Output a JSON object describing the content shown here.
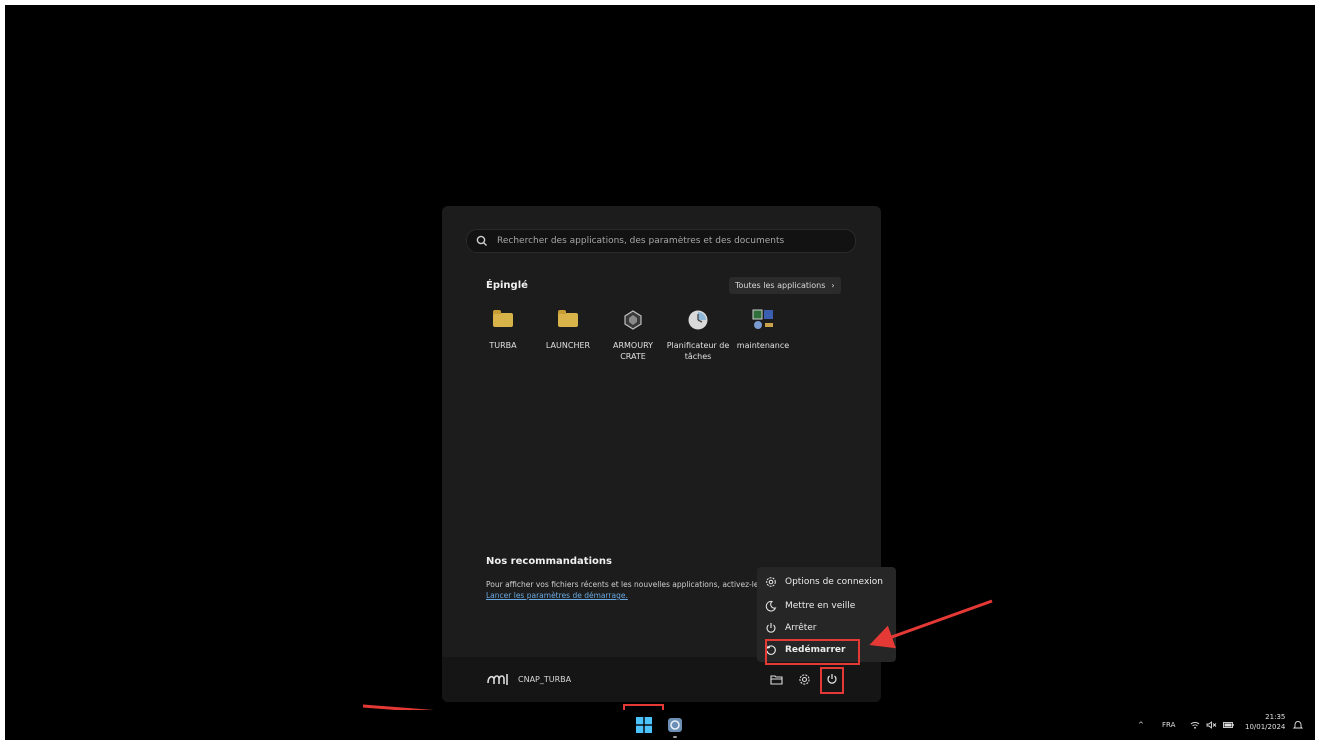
{
  "search": {
    "placeholder": "Rechercher des applications, des paramètres et des documents",
    "icon": "search-icon"
  },
  "pinned": {
    "title": "Épinglé",
    "all_apps_label": "Toutes les applications",
    "apps": [
      {
        "label": "TURBA",
        "icon": "folder-icon"
      },
      {
        "label": "LAUNCHER",
        "icon": "folder-icon"
      },
      {
        "label": "ARMOURY CRATE",
        "icon": "armoury-crate-icon"
      },
      {
        "label": "Planificateur de tâches",
        "icon": "task-scheduler-icon"
      },
      {
        "label": "maintenance",
        "icon": "maintenance-icon"
      }
    ]
  },
  "recommendations": {
    "title": "Nos recommandations",
    "text": "Pour afficher vos fichiers récents et les nouvelles applications, activez-les da",
    "link": "Lancer les paramètres de démarrage."
  },
  "user": {
    "name": "CNAP_TURBA"
  },
  "power_menu": {
    "items": [
      {
        "label": "Options de connexion",
        "icon": "gear-icon"
      },
      {
        "label": "Mettre en veille",
        "icon": "moon-icon"
      },
      {
        "label": "Arrêter",
        "icon": "power-icon"
      },
      {
        "label": "Redémarrer",
        "icon": "restart-icon"
      }
    ]
  },
  "taskbar": {
    "language": "FRA",
    "time": "21:35",
    "date": "10/01/2024"
  },
  "colors": {
    "highlight": "#e53935",
    "menu_bg": "#1c1c1c",
    "accent": "#4cc2ff"
  }
}
